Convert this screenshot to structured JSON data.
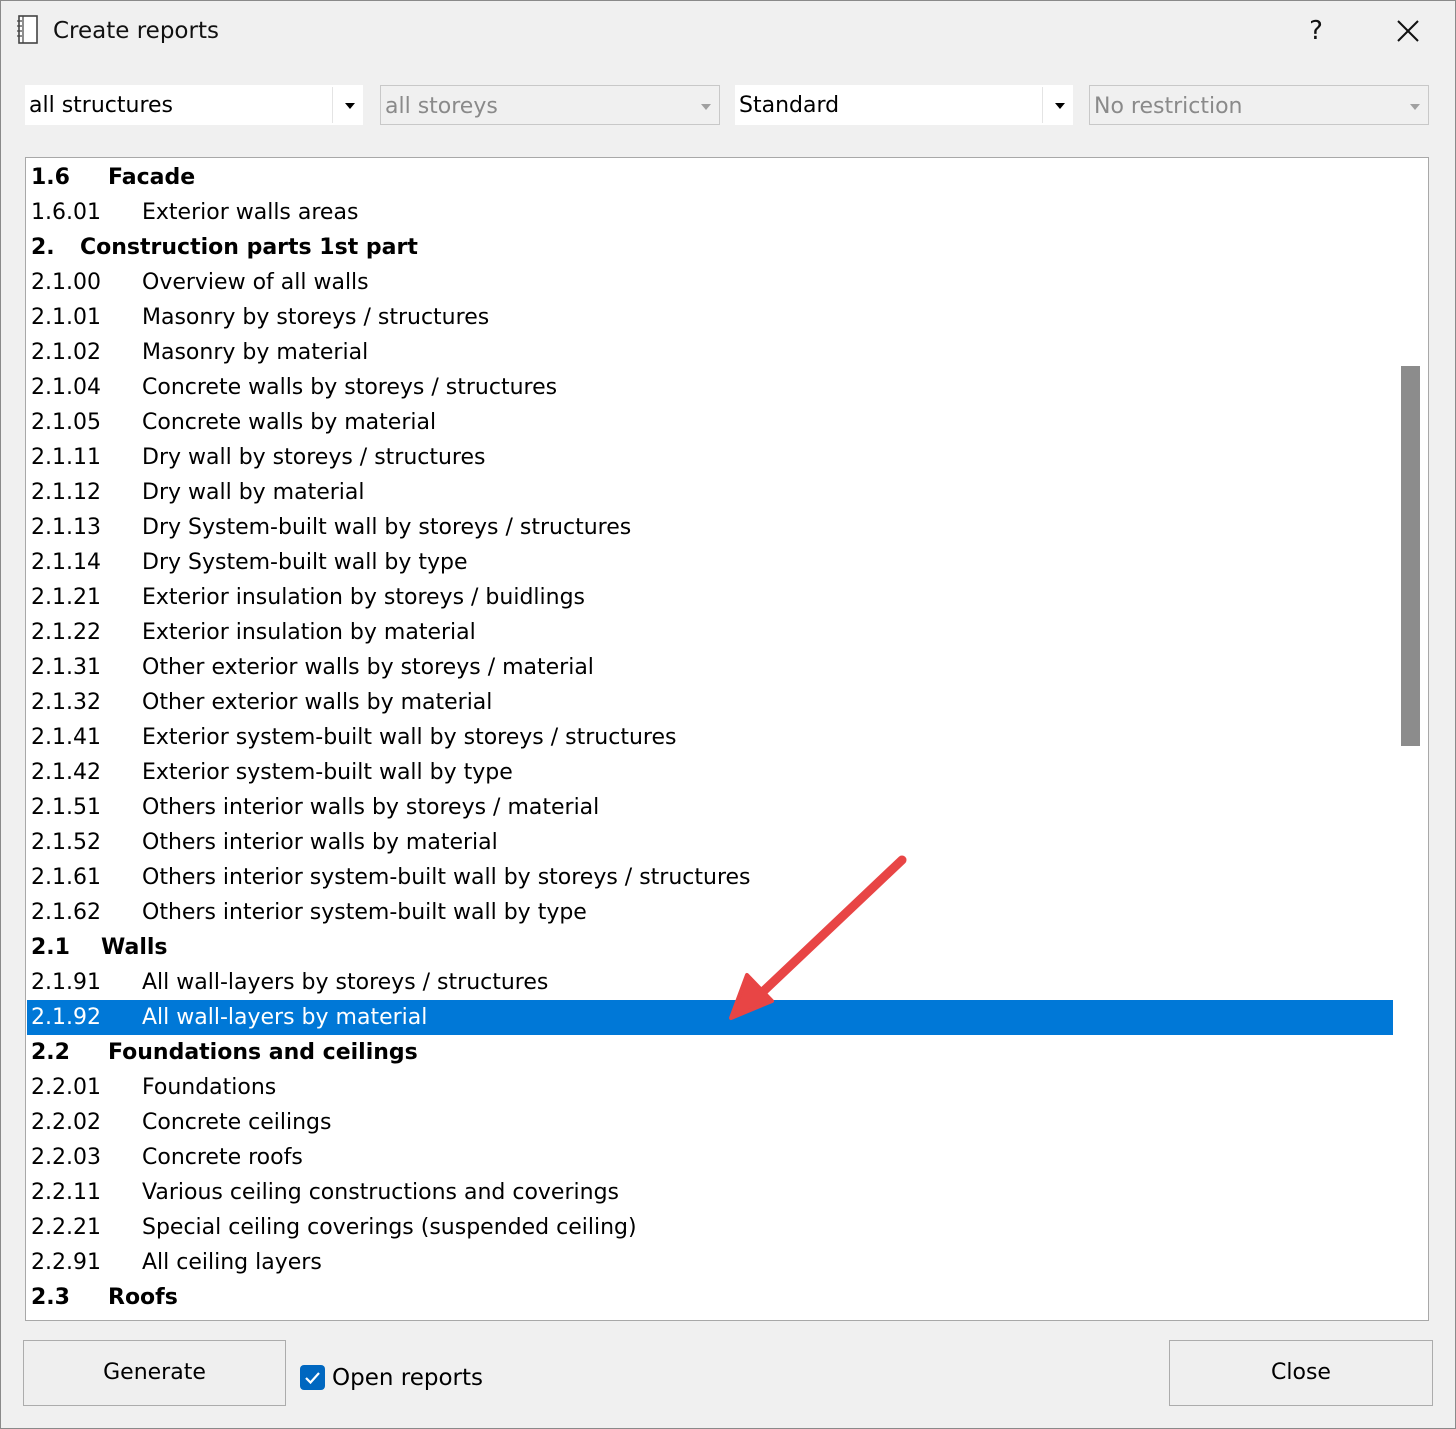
{
  "window": {
    "title": "Create reports",
    "help_label": "?"
  },
  "filters": {
    "structures": "all structures",
    "storeys": "all storeys",
    "standard": "Standard",
    "restriction": "No restriction"
  },
  "report_list": {
    "items": [
      {
        "num": "1.6",
        "label": "Facade",
        "heading": true
      },
      {
        "num": "1.6.01",
        "label": "Exterior walls areas"
      },
      {
        "num": "2.",
        "label": "Construction parts 1st part",
        "heading": true
      },
      {
        "num": "2.1.00",
        "label": "Overview of all walls"
      },
      {
        "num": "2.1.01",
        "label": "Masonry by storeys / structures"
      },
      {
        "num": "2.1.02",
        "label": "Masonry by material"
      },
      {
        "num": "2.1.04",
        "label": "Concrete walls by storeys / structures"
      },
      {
        "num": "2.1.05",
        "label": "Concrete walls by material"
      },
      {
        "num": "2.1.11",
        "label": "Dry wall by storeys / structures"
      },
      {
        "num": "2.1.12",
        "label": "Dry wall by material"
      },
      {
        "num": "2.1.13",
        "label": "Dry System-built wall by storeys / structures"
      },
      {
        "num": "2.1.14",
        "label": "Dry System-built wall by type"
      },
      {
        "num": "2.1.21",
        "label": "Exterior insulation by storeys / buidlings"
      },
      {
        "num": "2.1.22",
        "label": "Exterior insulation by material"
      },
      {
        "num": "2.1.31",
        "label": "Other exterior walls by storeys / material"
      },
      {
        "num": "2.1.32",
        "label": "Other exterior walls by material"
      },
      {
        "num": "2.1.41",
        "label": "Exterior system-built wall by storeys / structures"
      },
      {
        "num": "2.1.42",
        "label": "Exterior system-built wall by type"
      },
      {
        "num": "2.1.51",
        "label": "Others interior walls by storeys / material"
      },
      {
        "num": "2.1.52",
        "label": "Others interior walls by material"
      },
      {
        "num": "2.1.61",
        "label": "Others interior system-built wall by storeys / structures"
      },
      {
        "num": "2.1.62",
        "label": "Others interior system-built wall by type"
      },
      {
        "num": "2.1",
        "label": "Walls",
        "heading": true
      },
      {
        "num": "2.1.91",
        "label": "All wall-layers by storeys / structures"
      },
      {
        "num": "2.1.92",
        "label": "All wall-layers by material",
        "selected": true
      },
      {
        "num": "2.2",
        "label": "Foundations and ceilings",
        "heading": true
      },
      {
        "num": "2.2.01",
        "label": "Foundations"
      },
      {
        "num": "2.2.02",
        "label": "Concrete ceilings"
      },
      {
        "num": "2.2.03",
        "label": "Concrete roofs"
      },
      {
        "num": "2.2.11",
        "label": "Various ceiling constructions and coverings"
      },
      {
        "num": "2.2.21",
        "label": "Special ceiling coverings (suspended ceiling)"
      },
      {
        "num": "2.2.91",
        "label": "All ceiling layers"
      },
      {
        "num": "2.3",
        "label": "Roofs",
        "heading": true
      }
    ]
  },
  "footer": {
    "generate_label": "Generate",
    "open_reports_label": "Open reports",
    "open_reports_checked": true,
    "close_label": "Close"
  },
  "colors": {
    "selection": "#0078d7",
    "annotation_arrow": "#e84545",
    "checkbox": "#0067c0"
  }
}
